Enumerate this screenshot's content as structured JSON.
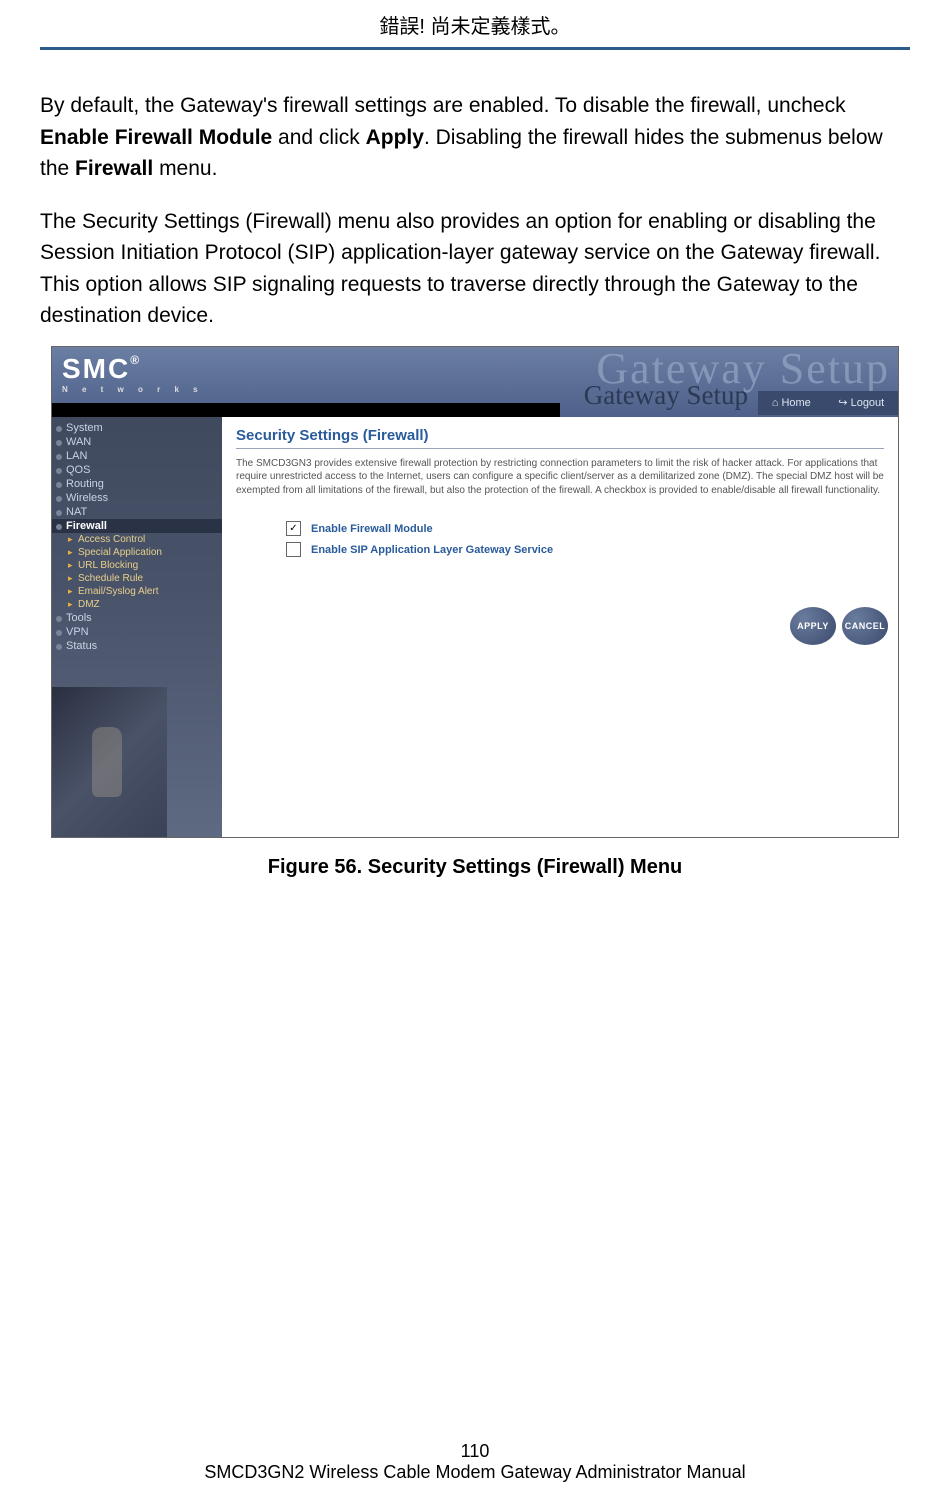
{
  "header": {
    "error_text": "錯誤! 尚未定義樣式。"
  },
  "body": {
    "p1_a": "By default, the Gateway's firewall settings are enabled. To disable the firewall, uncheck ",
    "p1_b1": "Enable Firewall Module",
    "p1_c": " and click ",
    "p1_b2": "Apply",
    "p1_d": ". Disabling the firewall hides the submenus below the ",
    "p1_b3": "Firewall",
    "p1_e": " menu.",
    "p2": "The Security Settings (Firewall) menu also provides an option for enabling or disabling the Session Initiation Protocol (SIP) application-layer gateway service on the Gateway firewall. This option allows SIP signaling requests to traverse directly through the Gateway to the destination device."
  },
  "screenshot": {
    "brand": "SMC",
    "brand_sub": "N e t w o r k s",
    "watermark": "Gateway Setup",
    "setup_label": "Gateway Setup",
    "home_link": "Home",
    "logout_link": "Logout",
    "nav": {
      "system": "System",
      "wan": "WAN",
      "lan": "LAN",
      "qos": "QOS",
      "routing": "Routing",
      "wireless": "Wireless",
      "nat": "NAT",
      "firewall": "Firewall",
      "sub_access": "Access Control",
      "sub_special": "Special Application",
      "sub_url": "URL Blocking",
      "sub_schedule": "Schedule Rule",
      "sub_email": "Email/Syslog Alert",
      "sub_dmz": "DMZ",
      "tools": "Tools",
      "vpn": "VPN",
      "status": "Status"
    },
    "panel": {
      "title": "Security Settings (Firewall)",
      "desc": "The SMCD3GN3 provides extensive firewall protection by restricting connection parameters to limit the risk of hacker attack. For applications that require unrestricted access to the Internet, users can configure a specific client/server as a demilitarized zone (DMZ). The special DMZ host will be exempted from all limitations of the firewall, but also the protection of the firewall. A checkbox is provided to enable/disable all firewall functionality.",
      "opt1_checked": "✓",
      "opt1": "Enable Firewall Module",
      "opt2": "Enable SIP Application Layer Gateway Service",
      "apply": "APPLY",
      "cancel": "CANCEL"
    }
  },
  "figure_caption": "Figure 56. Security Settings (Firewall) Menu",
  "footer": {
    "page_number": "110",
    "manual_title": "SMCD3GN2 Wireless Cable Modem Gateway Administrator Manual"
  }
}
